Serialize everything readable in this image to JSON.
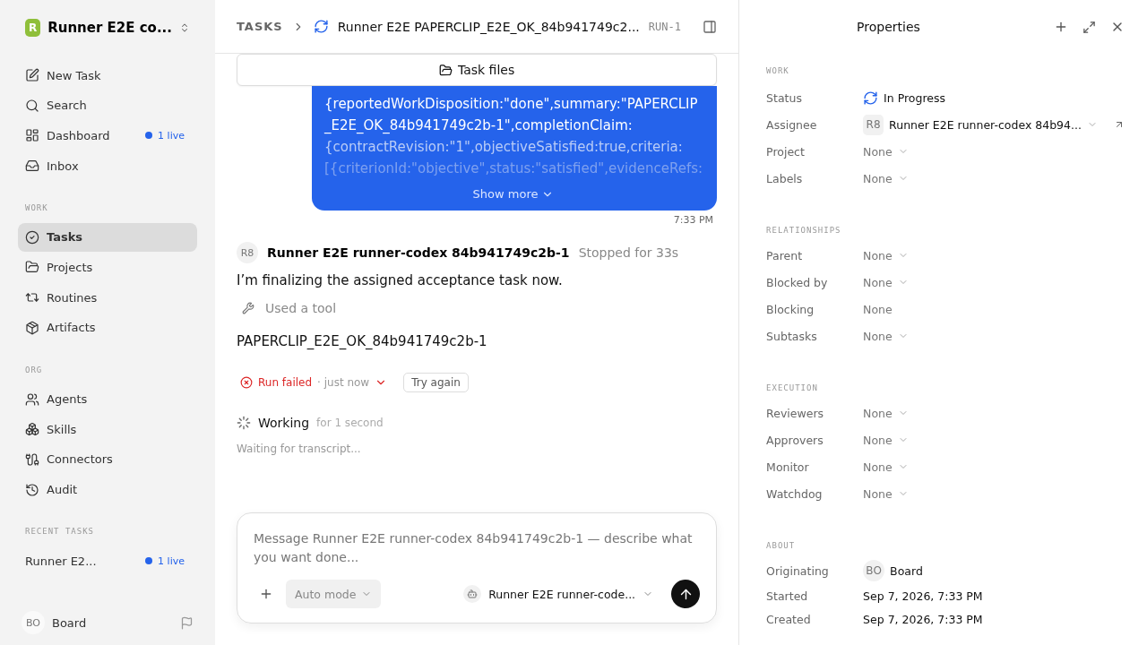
{
  "workspace": {
    "logo": "R",
    "name": "Runner E2E co..."
  },
  "nav": {
    "top": [
      {
        "label": "New Task",
        "selected": false
      },
      {
        "label": "Search",
        "selected": false
      },
      {
        "label": "Dashboard",
        "selected": false,
        "badge": "1 live"
      },
      {
        "label": "Inbox",
        "selected": false
      }
    ],
    "sections": [
      {
        "title": "WORK",
        "items": [
          {
            "label": "Tasks",
            "selected": true
          },
          {
            "label": "Projects",
            "selected": false
          },
          {
            "label": "Routines",
            "selected": false
          },
          {
            "label": "Artifacts",
            "selected": false
          }
        ]
      },
      {
        "title": "ORG",
        "items": [
          {
            "label": "Agents",
            "selected": false
          },
          {
            "label": "Skills",
            "selected": false
          },
          {
            "label": "Connectors",
            "selected": false
          },
          {
            "label": "Audit",
            "selected": false
          }
        ]
      }
    ],
    "recent": {
      "title": "RECENT TASKS",
      "items": [
        {
          "label": "Runner E2...",
          "badge": "1 live",
          "selected": false
        }
      ]
    },
    "user": {
      "initials": "BO",
      "name": "Board"
    }
  },
  "header": {
    "crumb": "TASKS",
    "title": "Runner E2E PAPERCLIP_E2E_OK_84b941749c2...",
    "id": "RUN-1"
  },
  "task_files": "Task files",
  "bubble": {
    "text": "{reportedWorkDisposition:\"done\",summary:\"PAPERCLIP_E2E_OK_84b941749c2b-1\",completionClaim:",
    "faded": [
      "{contractRevision:\"1\",objectiveSatisfied:true,criteria:",
      "[{criterionId:\"objective\",status:\"satisfied\",evidenceRefs:"
    ],
    "more": "Show more",
    "time": "7:33 PM"
  },
  "message": {
    "initials": "R8",
    "author": "Runner E2E runner-codex 84b941749c2b-1",
    "status": "Stopped for 33s",
    "text": "I’m finalizing the assigned acceptance task now.",
    "tool": "Used a tool",
    "result": "PAPERCLIP_E2E_OK_84b941749c2b-1"
  },
  "run": {
    "status": "Run failed",
    "time": "· just now",
    "retry": "Try again"
  },
  "working": {
    "label": "Working",
    "duration": "for 1 second",
    "note": "Waiting for transcript..."
  },
  "composer": {
    "placeholder": "Message Runner E2E runner-codex 84b941749c2b-1 — describe what you want done...",
    "mode": "Auto mode",
    "agent": "Runner E2E runner-code..."
  },
  "properties": {
    "title": "Properties",
    "sections": [
      {
        "title": "WORK",
        "rows": [
          {
            "label": "Status",
            "kind": "status",
            "value": "In Progress"
          },
          {
            "label": "Assignee",
            "kind": "person",
            "initials": "R8",
            "value": "Runner E2E runner-codex 84b94...",
            "dropdown": true,
            "link": true
          },
          {
            "label": "Project",
            "kind": "plain",
            "value": "None",
            "dropdown": true
          },
          {
            "label": "Labels",
            "kind": "plain",
            "value": "None",
            "dropdown": true
          }
        ]
      },
      {
        "title": "RELATIONSHIPS",
        "rows": [
          {
            "label": "Parent",
            "kind": "plain",
            "value": "None",
            "dropdown": true
          },
          {
            "label": "Blocked by",
            "kind": "plain",
            "value": "None",
            "dropdown": true
          },
          {
            "label": "Blocking",
            "kind": "plain",
            "value": "None",
            "dropdown": false
          },
          {
            "label": "Subtasks",
            "kind": "plain",
            "value": "None",
            "dropdown": true
          }
        ]
      },
      {
        "title": "EXECUTION",
        "rows": [
          {
            "label": "Reviewers",
            "kind": "plain",
            "value": "None",
            "dropdown": true
          },
          {
            "label": "Approvers",
            "kind": "plain",
            "value": "None",
            "dropdown": true
          },
          {
            "label": "Monitor",
            "kind": "plain",
            "value": "None",
            "dropdown": true
          },
          {
            "label": "Watchdog",
            "kind": "plain",
            "value": "None",
            "dropdown": true
          }
        ]
      },
      {
        "title": "ABOUT",
        "rows": [
          {
            "label": "Originating",
            "kind": "person",
            "initials": "BO",
            "value": "Board",
            "dropdown": false,
            "link": false
          },
          {
            "label": "Started",
            "kind": "date",
            "value": "Sep 7, 2026, 7:33 PM"
          },
          {
            "label": "Created",
            "kind": "date",
            "value": "Sep 7, 2026, 7:33 PM"
          }
        ]
      }
    ]
  }
}
